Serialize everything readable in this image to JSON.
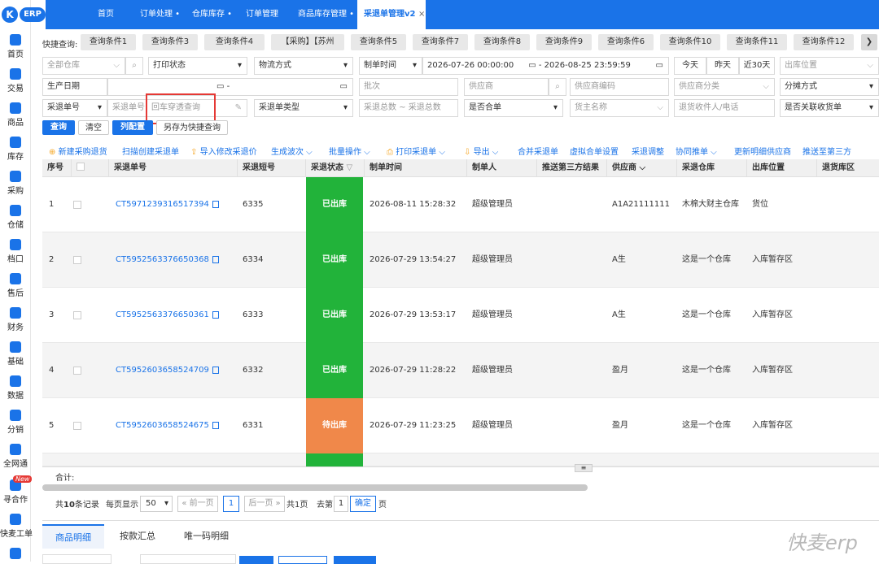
{
  "app": {
    "logo_letter": "K",
    "logo_text": "ERP",
    "brand_color": "#1a73e8",
    "watermark": "快麦erp"
  },
  "sidebar": {
    "items": [
      {
        "label": "首页",
        "icon": "home-icon"
      },
      {
        "label": "交易",
        "icon": "document-icon"
      },
      {
        "label": "商品",
        "icon": "bag-icon"
      },
      {
        "label": "库存",
        "icon": "box-icon"
      },
      {
        "label": "采购",
        "icon": "cart-icon"
      },
      {
        "label": "仓储",
        "icon": "warehouse-icon"
      },
      {
        "label": "档口",
        "icon": "store-icon"
      },
      {
        "label": "售后",
        "icon": "service-icon"
      },
      {
        "label": "财务",
        "icon": "finance-icon"
      },
      {
        "label": "基础",
        "icon": "gear-icon"
      },
      {
        "label": "数据",
        "icon": "chart-icon"
      },
      {
        "label": "分销",
        "icon": "distribution-icon"
      },
      {
        "label": "全网通",
        "icon": "network-icon"
      },
      {
        "label": "寻合作",
        "icon": "handshake-icon"
      },
      {
        "label": "快麦工单",
        "icon": "ticket-icon"
      }
    ],
    "new_badge": "New"
  },
  "tabs": [
    {
      "label": "首页"
    },
    {
      "label": "订单处理 •"
    },
    {
      "label": "仓库库存 •"
    },
    {
      "label": "订单管理"
    },
    {
      "label": "商品库存管理 •"
    },
    {
      "label": "采退单管理v2",
      "close": "×"
    }
  ],
  "quick_query": {
    "label": "快捷查询:",
    "items": [
      "查询条件1",
      "查询条件3",
      "查询条件4",
      "【采购】【苏州",
      "查询条件5",
      "查询条件7",
      "查询条件8",
      "查询条件9",
      "查询条件6",
      "查询条件10",
      "查询条件11",
      "查询条件12"
    ],
    "more": "❯"
  },
  "filters": {
    "all_warehouse": "全部仓库",
    "print_status": "打印状态",
    "logistics": "物流方式",
    "create_time": "制单时间",
    "date_start": "2026-07-26 00:00:00",
    "date_sep": "-",
    "date_end": "2026-08-25 23:59:59",
    "today": "今天",
    "yesterday": "昨天",
    "last30": "近30天",
    "out_position": "出库位置",
    "prod_date": "生产日期",
    "range_sep": "-",
    "batch": "批次",
    "supplier": "供应商",
    "supplier_code": "供应商编码",
    "supplier_category": "供应商分类",
    "allocation": "分摊方式",
    "return_no_type": "采退单号",
    "return_no": "采退单号",
    "penetration": "回车穿透查询",
    "return_type": "采退单类型",
    "total_min": "采退总数",
    "tilde": "~",
    "total_max": "采退总数",
    "merged": "是否合单",
    "owner": "货主名称",
    "receiver": "退货收件人/电话",
    "related": "是否关联收货单"
  },
  "buttons": {
    "query": "查询",
    "clear": "清空",
    "columns": "列配置",
    "save_quick": "另存为快捷查询"
  },
  "actions": [
    "新建采购退货",
    "扫描创建采退单",
    "导入修改采退价",
    "生成波次 ⌵",
    "批量操作 ⌵",
    "打印采退单 ⌵",
    "导出 ⌵",
    "合并采退单",
    "虚拟合单设置",
    "采退调整",
    "协同推单 ⌵",
    "更新明细供应商",
    "推送至第三方"
  ],
  "table": {
    "headers": [
      "序号",
      "",
      "采退单号",
      "采退短号",
      "采退状态",
      "制单时间",
      "制单人",
      "推送第三方结果",
      "供应商",
      "采退仓库",
      "出库位置",
      "退货库区"
    ],
    "status_colors": {
      "已出库": "#22b33a",
      "待出库": "#f0884a"
    },
    "rows": [
      {
        "idx": "1",
        "no": "CT5971239316517394",
        "short": "6335",
        "status": "已出库",
        "time": "2026-08-11 15:28:32",
        "creator": "超级管理员",
        "push": "",
        "supplier": "A1A21111111",
        "warehouse": "木棉大财主仓库",
        "pos": "货位",
        "area": ""
      },
      {
        "idx": "2",
        "no": "CT5952563376650368",
        "short": "6334",
        "status": "已出库",
        "time": "2026-07-29 13:54:27",
        "creator": "超级管理员",
        "push": "",
        "supplier": "A生",
        "warehouse": "这是一个仓库",
        "pos": "入库暂存区",
        "area": ""
      },
      {
        "idx": "3",
        "no": "CT5952563376650361",
        "short": "6333",
        "status": "已出库",
        "time": "2026-07-29 13:53:17",
        "creator": "超级管理员",
        "push": "",
        "supplier": "A生",
        "warehouse": "这是一个仓库",
        "pos": "入库暂存区",
        "area": ""
      },
      {
        "idx": "4",
        "no": "CT5952603658524709",
        "short": "6332",
        "status": "已出库",
        "time": "2026-07-29 11:28:22",
        "creator": "超级管理员",
        "push": "",
        "supplier": "盈月",
        "warehouse": "这是一个仓库",
        "pos": "入库暂存区",
        "area": ""
      },
      {
        "idx": "5",
        "no": "CT5952603658524675",
        "short": "6331",
        "status": "待出库",
        "time": "2026-07-29 11:23:25",
        "creator": "超级管理员",
        "push": "",
        "supplier": "盈月",
        "warehouse": "这是一个仓库",
        "pos": "入库暂存区",
        "area": ""
      }
    ],
    "sum_label": "合计:"
  },
  "pagination": {
    "total_pre": "共",
    "total": "10",
    "total_post": "条记录",
    "per_page_label": "每页显示",
    "per_page": "50",
    "prev": "« 前一页",
    "current": "1",
    "next": "后一页 »",
    "pages": "共1页",
    "goto_label": "去第",
    "goto_value": "1",
    "confirm": "确定",
    "page_unit": "页"
  },
  "bottom_tabs": [
    "商品明细",
    "按款汇总",
    "唯一码明细"
  ]
}
